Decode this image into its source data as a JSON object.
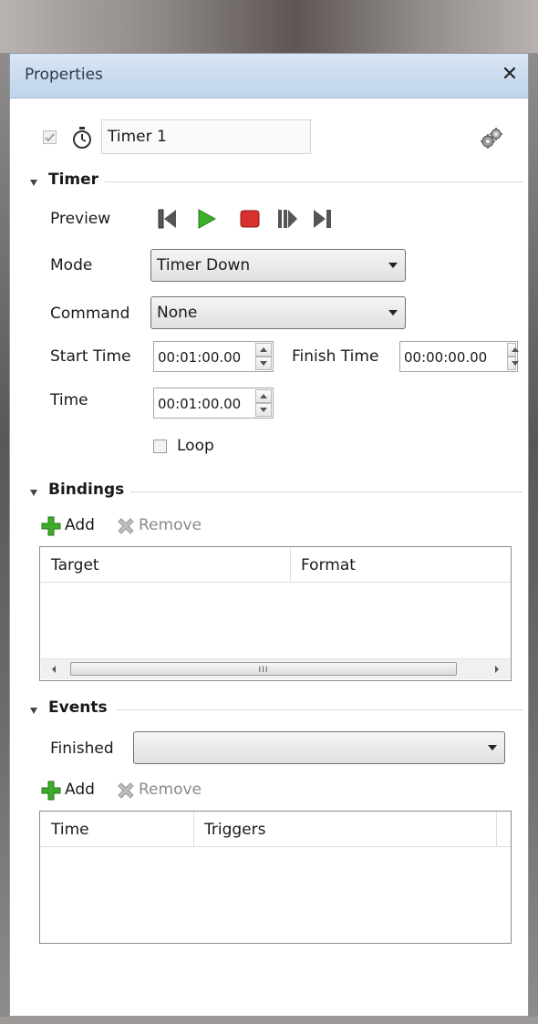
{
  "panel": {
    "title": "Properties",
    "close_glyph": "✕"
  },
  "object": {
    "name": "Timer 1",
    "enabled": true
  },
  "timer": {
    "section_label": "Timer",
    "preview_label": "Preview",
    "mode_label": "Mode",
    "mode_value": "Timer Down",
    "command_label": "Command",
    "command_value": "None",
    "start_time_label": "Start Time",
    "start_time_value": "00:01:00.00",
    "finish_time_label": "Finish Time",
    "finish_time_value": "00:00:00.00",
    "time_label": "Time",
    "time_value": "00:01:00.00",
    "loop_label": "Loop",
    "loop_checked": false
  },
  "bindings": {
    "section_label": "Bindings",
    "add_label": "Add",
    "remove_label": "Remove",
    "columns": [
      "Target",
      "Format"
    ],
    "scroll_grip": "III"
  },
  "events": {
    "section_label": "Events",
    "finished_label": "Finished",
    "finished_value": "",
    "add_label": "Add",
    "remove_label": "Remove",
    "columns": [
      "Time",
      "Triggers"
    ]
  },
  "colors": {
    "play_green": "#3fae2a",
    "stop_red": "#d6312e",
    "add_green": "#3faa2b",
    "remove_gray": "#a9a9a9",
    "header_blue": "#cfdff0"
  }
}
